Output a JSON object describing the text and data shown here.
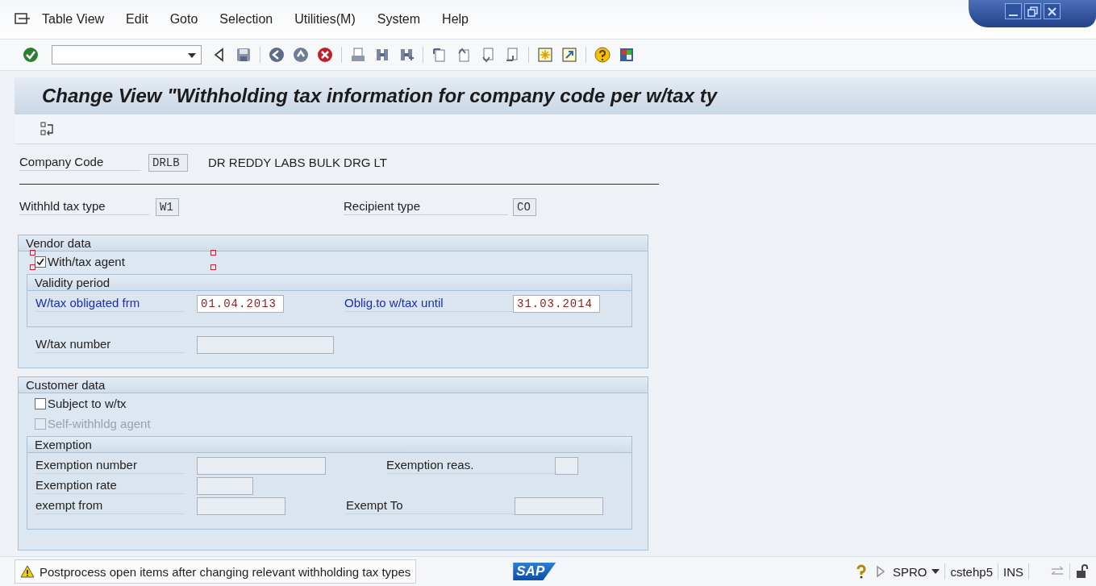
{
  "menu": [
    "Table View",
    "Edit",
    "Goto",
    "Selection",
    "Utilities(M)",
    "System",
    "Help"
  ],
  "title": "Change View \"Withholding tax information for company code per w/tax ty",
  "company": {
    "label": "Company Code",
    "value": "DRLB",
    "description": "DR REDDY LABS BULK DRG LT"
  },
  "key_fields": [
    {
      "label": "Withhld tax type",
      "value": "W1"
    },
    {
      "label": "Recipient type",
      "value": "CO"
    }
  ],
  "vendor_data": {
    "title": "Vendor data",
    "checkboxes": [
      {
        "label": "With/tax agent",
        "checked": true,
        "disabled": false,
        "selected": true
      }
    ],
    "group": {
      "title": "Validity period",
      "rows": [
        [
          {
            "label": "W/tax obligated frm",
            "value": "01.04.2013",
            "editable": true
          },
          {
            "label": "Oblig.to w/tax until",
            "value": "31.03.2014",
            "editable": true
          }
        ]
      ]
    },
    "after_rows": [
      [
        {
          "label": "W/tax number",
          "editable": false
        }
      ]
    ]
  },
  "customer_data": {
    "title": "Customer data",
    "checkboxes": [
      {
        "label": "Subject to w/tx",
        "checked": false,
        "disabled": false,
        "selected": false
      },
      {
        "label": "Self-withhldg agent",
        "checked": false,
        "disabled": true,
        "selected": false
      }
    ],
    "group": {
      "title": "Exemption",
      "rows": [
        [
          {
            "label": "Exemption number",
            "editable": false
          },
          {
            "label": "Exemption reas.",
            "editable": false
          }
        ],
        [
          {
            "label": "Exemption rate",
            "editable": false
          }
        ],
        [
          {
            "label": "exempt from",
            "editable": false
          },
          {
            "label": "Exempt To",
            "editable": false
          }
        ]
      ]
    }
  },
  "status_bar": {
    "message": "Postprocess open items after changing relevant withholding tax types",
    "kind": "warning",
    "logo": "SAP",
    "transaction": "SPRO",
    "user": "cstehp5",
    "mode": "INS"
  }
}
